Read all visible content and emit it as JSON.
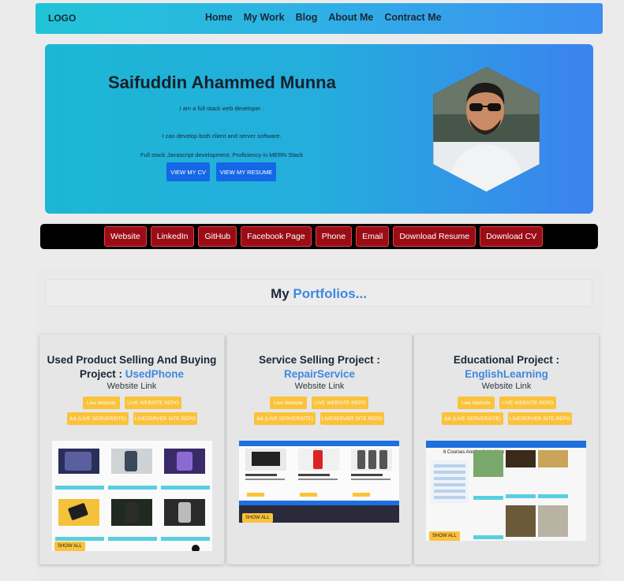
{
  "navbar": {
    "logo": "LOGO",
    "links": [
      "Home",
      "My Work",
      "Blog",
      "About Me",
      "Contract Me"
    ]
  },
  "hero": {
    "name": "Saifuddin Ahammed Munna",
    "line1": "I am a full stack web developer .",
    "line2": "I can develop both client and server software.",
    "line3": "Full stack Javascript development. Proficiency in MERN Stack",
    "btn_cv": "VIEW MY CV",
    "btn_resume": "VIEW MY RESUME"
  },
  "links_bar": [
    "Website",
    "LinkedIn",
    "GitHub",
    "Facebook Page",
    "Phone",
    "Email",
    "Download Resume",
    "Download CV"
  ],
  "portfolio": {
    "heading_prefix": "My",
    "heading_accent": "Portfolios...",
    "cards": [
      {
        "title_prefix": "Used Product Selling And Buying Project :",
        "title_accent": "UsedPhone",
        "subtitle": "Website Link",
        "pill_live": "Live Website",
        "pill_repo": "LIVE WEBSITE REPO",
        "pill_server": "&& (LIVE SERVERSITE)",
        "pill_server_repo": "LIVESERVER SITE REPO",
        "show_all": "SHOW ALL"
      },
      {
        "title_prefix": "Service Selling Project :",
        "title_accent": "RepairService",
        "subtitle": "Website Link",
        "pill_live": "Live Website",
        "pill_repo": "LIVE WEBSITE REPO",
        "pill_server": "&& (LIVE SERVERSITE)",
        "pill_server_repo": "LIVESERVER SITE REPO",
        "show_all": "SHOW ALL"
      },
      {
        "title_prefix": "Educational Project :",
        "title_accent": "EnglishLearning",
        "subtitle": "Website Link",
        "pill_live": "Live Website",
        "pill_repo": "LIVE WEBSITE REPO",
        "pill_server": "&& (LIVE SERVERSITE)",
        "pill_server_repo": "LIVESERVER SITE REPO",
        "show_all": "SHOW ALL",
        "screenshot_caption": "6 Courses Are Available Now"
      }
    ]
  },
  "colors": {
    "accent": "#3f88df",
    "link_button": "#9b0d16",
    "pill": "#fbc23a",
    "hero_button": "#1567e6"
  }
}
